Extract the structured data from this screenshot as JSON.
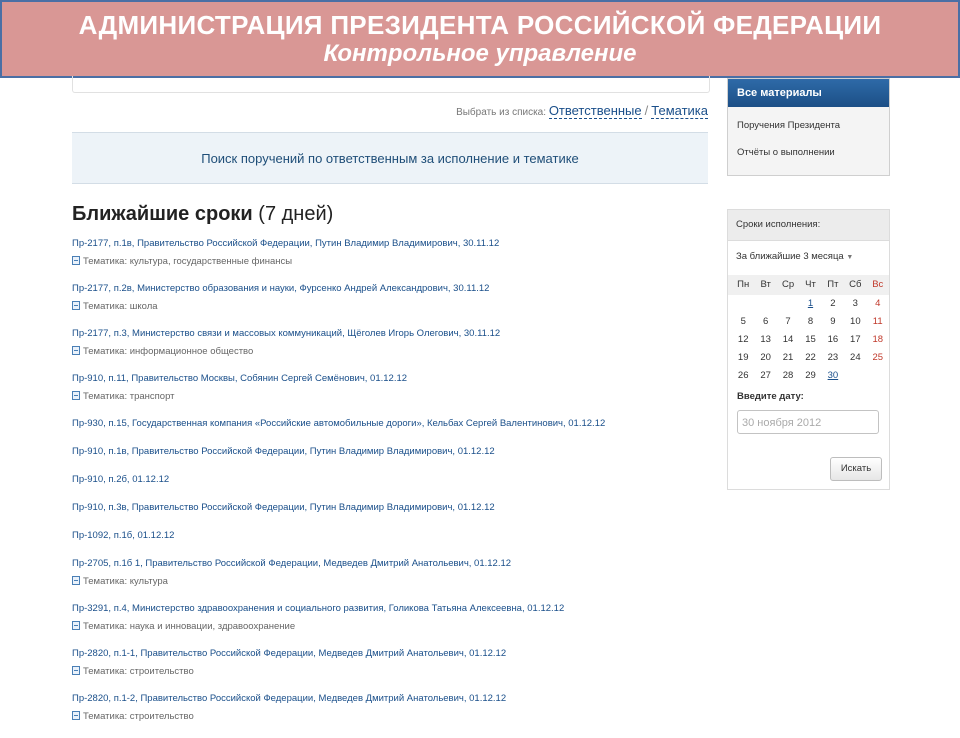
{
  "banner": {
    "title": "АДМИНИСТРАЦИЯ ПРЕЗИДЕНТА РОССИЙСКОЙ ФЕДЕРАЦИИ",
    "subtitle": "Контрольное управление"
  },
  "select": {
    "prefix": "Выбрать из списка:",
    "responsible": "Ответственные",
    "separator": "/",
    "theme": "Тематика"
  },
  "search_bar": "Поиск поручений по ответственным за исполнение и тематике",
  "heading": {
    "bold": "Ближайшие сроки",
    "light": "(7 дней)"
  },
  "tasks": [
    {
      "line": "Пр-2177, п.1в, Правительство Российской Федерации, Путин Владимир Владимирович, 30.11.12",
      "theme": "Тематика: культура, государственные финансы"
    },
    {
      "line": "Пр-2177, п.2в, Министерство образования и науки, Фурсенко Андрей Александрович, 30.11.12",
      "theme": "Тематика: школа"
    },
    {
      "line": "Пр-2177, п.3, Министерство связи и массовых коммуникаций, Щёголев Игорь Олегович, 30.11.12",
      "theme": "Тематика: информационное общество"
    },
    {
      "line": "Пр-910, п.11, Правительство Москвы, Собянин Сергей Семёнович, 01.12.12",
      "theme": "Тематика: транспорт"
    },
    {
      "line": "Пр-930, п.15, Государственная компания «Российские автомобильные дороги», Кельбах Сергей Валентинович, 01.12.12",
      "theme": ""
    },
    {
      "line": "Пр-910, п.1в, Правительство Российской Федерации, Путин Владимир Владимирович, 01.12.12",
      "theme": ""
    },
    {
      "line": "Пр-910, п.2б, 01.12.12",
      "theme": ""
    },
    {
      "line": "Пр-910, п.3в, Правительство Российской Федерации, Путин Владимир Владимирович, 01.12.12",
      "theme": ""
    },
    {
      "line": "Пр-1092, п.1б, 01.12.12",
      "theme": ""
    },
    {
      "line": "Пр-2705, п.1б 1, Правительство Российской Федерации, Медведев Дмитрий Анатольевич, 01.12.12",
      "theme": "Тематика: культура"
    },
    {
      "line": "Пр-3291, п.4, Министерство здравоохранения и социального развития, Голикова Татьяна Алексеевна, 01.12.12",
      "theme": "Тематика: наука и инновации, здравоохранение"
    },
    {
      "line": "Пр-2820, п.1-1, Правительство Российской Федерации, Медведев Дмитрий Анатольевич, 01.12.12",
      "theme": "Тематика: строительство"
    },
    {
      "line": "Пр-2820, п.1-2, Правительство Российской Федерации, Медведев Дмитрий Анатольевич, 01.12.12",
      "theme": "Тематика: строительство"
    }
  ],
  "materials": {
    "title": "Все материалы",
    "items": [
      "Поручения Президента",
      "Отчёты о выполнении"
    ]
  },
  "deadlines": {
    "title": "Сроки исполнения:",
    "period": "За ближайшие 3 месяца",
    "weekdays": [
      "Пн",
      "Вт",
      "Ср",
      "Чт",
      "Пт",
      "Сб",
      "Вс"
    ],
    "weeks": [
      [
        "",
        "",
        "",
        "1",
        "2",
        "3",
        "4"
      ],
      [
        "5",
        "6",
        "7",
        "8",
        "9",
        "10",
        "11"
      ],
      [
        "12",
        "13",
        "14",
        "15",
        "16",
        "17",
        "18"
      ],
      [
        "19",
        "20",
        "21",
        "22",
        "23",
        "24",
        "25"
      ],
      [
        "26",
        "27",
        "28",
        "29",
        "30",
        "",
        ""
      ]
    ],
    "date_label": "Введите дату:",
    "date_placeholder": "30 ноября 2012",
    "find_button": "Искать"
  }
}
